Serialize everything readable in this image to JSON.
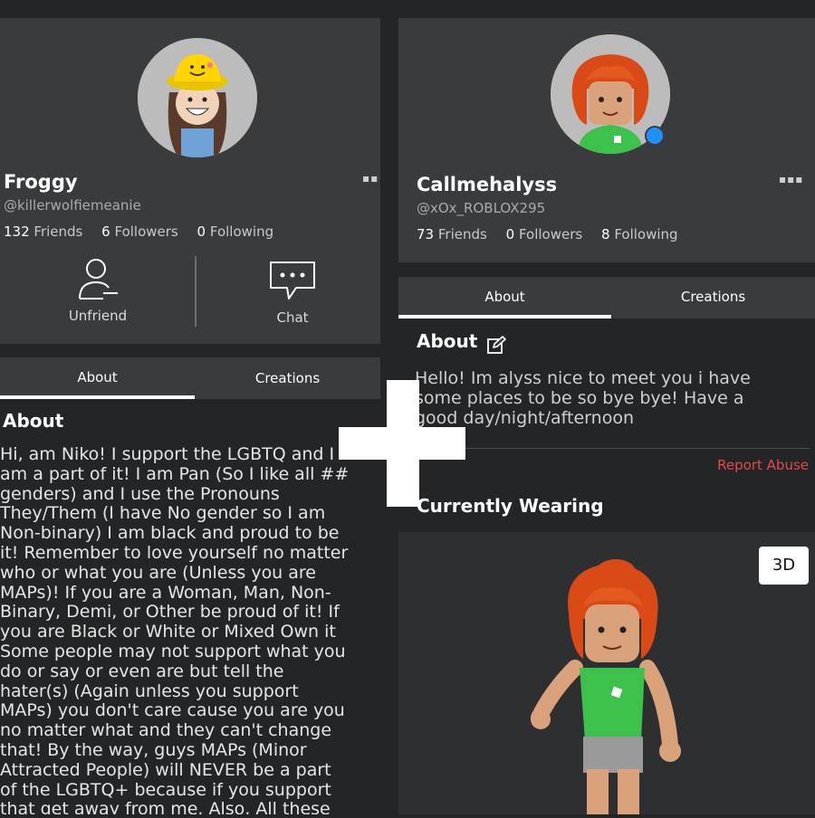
{
  "left_profile": {
    "display_name": "Froggy",
    "username": "@killerwolfiemeanie",
    "friends_count": "132",
    "friends_label": "Friends",
    "followers_count": "6",
    "followers_label": "Followers",
    "following_count": "0",
    "following_label": "Following",
    "more_icon": "more-dots-icon",
    "actions": {
      "unfriend_label": "Unfriend",
      "unfriend_icon": "user-minus-icon",
      "chat_label": "Chat",
      "chat_icon": "chat-bubble-icon"
    },
    "tabs": {
      "about": "About",
      "creations": "Creations"
    },
    "about_heading": "About",
    "about_text": "Hi, am Niko! I support the LGBTQ and I\nam a part of it! I am Pan (So I like all ##\ngenders) and I use the Pronouns\nThey/Them (I have No gender so I am\nNon-binary) I am black and proud to be\nit! Remember to love yourself no matter\nwho or what you are (Unless you are\nMAPs)! If you are a Woman, Man, Non-\nBinary, Demi, or Other be proud of it! If\nyou are Black or White or Mixed Own it\nSome people may not support what you\ndo or say or even are but tell the\nhater(s) (Again unless you support\nMAPs) you don't care cause you are you\nno matter what and they can't change\nthat! By the way, guys MAPs (Minor\nAttracted People) will NEVER be a part\nof the LGBTQ+ because if you support\nthat get away from me. Also, All these"
  },
  "right_profile": {
    "display_name": "Callmehalyss",
    "username": "@xOx_ROBLOX295",
    "friends_count": "73",
    "friends_label": "Friends",
    "followers_count": "0",
    "followers_label": "Followers",
    "following_count": "8",
    "following_label": "Following",
    "more_icon": "more-dots-icon",
    "online_status_color": "#1e90ff",
    "tabs": {
      "about": "About",
      "creations": "Creations"
    },
    "about_heading": "About",
    "edit_icon": "edit-pencil-icon",
    "about_text": "Hello! Im alyss nice to meet you i have\nsome places to be so bye bye! Have a\ngood day/night/afternoon",
    "report_label": "Report Abuse",
    "wearing_heading": "Currently Wearing",
    "view_3d_label": "3D"
  },
  "overlay": {
    "plus_icon": "plus-sign-icon"
  },
  "colors": {
    "background": "#232527",
    "panel": "#393b3d",
    "report": "#e5484d",
    "avatar_bg": "#bcbcbc"
  }
}
